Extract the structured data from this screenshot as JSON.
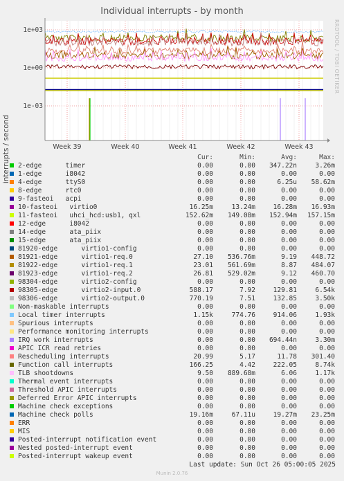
{
  "chart_data": {
    "type": "line",
    "title": "Individual interrupts - by month",
    "ylabel": "interrupts / second",
    "y_scale": "log",
    "y_ticks": [
      "1e+03",
      "1e+00",
      "1e-03"
    ],
    "x_ticks": [
      "Week 39",
      "Week 40",
      "Week 41",
      "Week 42",
      "Week 43"
    ],
    "grid": true,
    "legend_placement": "bottom",
    "series_levels": [
      {
        "name": "Local timer interrupts",
        "color": "#80c0ff",
        "level": 700,
        "style": "dense-dotted"
      },
      {
        "name": "Rescheduling interrupts",
        "color": "#e08070",
        "level": 20,
        "style": "spiky"
      },
      {
        "name": "Function call interrupts",
        "color": "#808000",
        "level": 200,
        "style": "spiky"
      },
      {
        "name": "98305-edge virtio2-input.0",
        "color": "#cc0000",
        "level": 120,
        "style": "spiky"
      },
      {
        "name": "98306-edge virtio2-output.0",
        "color": "#c08080",
        "level": 100,
        "style": "spiky"
      },
      {
        "name": "81921-edge virtio1-req.0",
        "color": "#a06000",
        "level": 9,
        "style": "spiky"
      },
      {
        "name": "TLB shootdowns",
        "color": "#ff99ff",
        "level": 6,
        "style": "spiky"
      },
      {
        "name": "12-edge i8042",
        "color": "#7f0000",
        "level": 1.2,
        "style": "noisy"
      },
      {
        "name": "10-fasteoi virtio0",
        "color": "#c0c000",
        "level": 0.0162,
        "style": "flat"
      },
      {
        "name": "11-fasteoi uhci_hcd:usb1, qxl",
        "color": "#cccc00",
        "level": 0.1529,
        "style": "flat"
      },
      {
        "name": "Machine check polls",
        "color": "#00007f",
        "level": 0.0193,
        "style": "flat"
      }
    ]
  },
  "credit": "RRDTOOL / TOBI OETIKER",
  "legend": {
    "headers": {
      "cur": "Cur:",
      "min": "Min:",
      "avg": "Avg:",
      "max": "Max:"
    },
    "rows": [
      {
        "color": "#00cc00",
        "name": "2-edge      timer",
        "cur": "0.00",
        "min": "0.00",
        "avg": "347.22n",
        "max": "3.26m"
      },
      {
        "color": "#0066b3",
        "name": "1-edge      i8042",
        "cur": "0.00",
        "min": "0.00",
        "avg": "0.00",
        "max": "0.00"
      },
      {
        "color": "#ff8000",
        "name": "4-edge      ttyS0",
        "cur": "0.00",
        "min": "0.00",
        "avg": "6.25u",
        "max": "58.62m"
      },
      {
        "color": "#ffcc00",
        "name": "8-edge      rtc0",
        "cur": "0.00",
        "min": "0.00",
        "avg": "0.00",
        "max": "0.00"
      },
      {
        "color": "#330099",
        "name": "9-fasteoi   acpi",
        "cur": "0.00",
        "min": "0.00",
        "avg": "0.00",
        "max": "0.00"
      },
      {
        "color": "#990099",
        "name": "10-fasteoi   virtio0",
        "cur": "16.25m",
        "min": "13.24m",
        "avg": "16.28m",
        "max": "16.93m"
      },
      {
        "color": "#ccff00",
        "name": "11-fasteoi   uhci_hcd:usb1, qxl",
        "cur": "152.62m",
        "min": "149.08m",
        "avg": "152.94m",
        "max": "157.15m"
      },
      {
        "color": "#ff0000",
        "name": "12-edge      i8042",
        "cur": "0.00",
        "min": "0.00",
        "avg": "0.00",
        "max": "0.00"
      },
      {
        "color": "#808080",
        "name": "14-edge      ata_piix",
        "cur": "0.00",
        "min": "0.00",
        "avg": "0.00",
        "max": "0.00"
      },
      {
        "color": "#008f00",
        "name": "15-edge      ata_piix",
        "cur": "0.00",
        "min": "0.00",
        "avg": "0.00",
        "max": "0.00"
      },
      {
        "color": "#00487d",
        "name": "81920-edge      virtio1-config",
        "cur": "0.00",
        "min": "0.00",
        "avg": "0.00",
        "max": "0.00"
      },
      {
        "color": "#b35a00",
        "name": "81921-edge      virtio1-req.0",
        "cur": "27.10",
        "min": "536.76m",
        "avg": "9.19",
        "max": "448.72"
      },
      {
        "color": "#b38f00",
        "name": "81922-edge      virtio1-req.1",
        "cur": "23.01",
        "min": "561.69m",
        "avg": "8.87",
        "max": "484.07"
      },
      {
        "color": "#6b006b",
        "name": "81923-edge      virtio1-req.2",
        "cur": "26.81",
        "min": "529.02m",
        "avg": "9.12",
        "max": "460.70"
      },
      {
        "color": "#8fb300",
        "name": "98304-edge      virtio2-config",
        "cur": "0.00",
        "min": "0.00",
        "avg": "0.00",
        "max": "0.00"
      },
      {
        "color": "#b30000",
        "name": "98305-edge      virtio2-input.0",
        "cur": "588.17",
        "min": "7.92",
        "avg": "129.81",
        "max": "6.54k"
      },
      {
        "color": "#bebebe",
        "name": "98306-edge      virtio2-output.0",
        "cur": "770.19",
        "min": "7.51",
        "avg": "132.85",
        "max": "3.50k"
      },
      {
        "color": "#80ff80",
        "name": "Non-maskable interrupts",
        "cur": "0.00",
        "min": "0.00",
        "avg": "0.00",
        "max": "0.00"
      },
      {
        "color": "#80c9ff",
        "name": "Local timer interrupts",
        "cur": "1.15k",
        "min": "774.76",
        "avg": "914.06",
        "max": "1.93k"
      },
      {
        "color": "#ffc080",
        "name": "Spurious interrupts",
        "cur": "0.00",
        "min": "0.00",
        "avg": "0.00",
        "max": "0.00"
      },
      {
        "color": "#ffe680",
        "name": "Performance monitoring interrupts",
        "cur": "0.00",
        "min": "0.00",
        "avg": "0.00",
        "max": "0.00"
      },
      {
        "color": "#aa80ff",
        "name": "IRQ work interrupts",
        "cur": "0.00",
        "min": "0.00",
        "avg": "694.44n",
        "max": "3.30m"
      },
      {
        "color": "#ee00cc",
        "name": "APIC ICR read retries",
        "cur": "0.00",
        "min": "0.00",
        "avg": "0.00",
        "max": "0.00"
      },
      {
        "color": "#ff8080",
        "name": "Rescheduling interrupts",
        "cur": "20.99",
        "min": "5.17",
        "avg": "11.78",
        "max": "301.40"
      },
      {
        "color": "#666600",
        "name": "Function call interrupts",
        "cur": "166.25",
        "min": "4.42",
        "avg": "222.05",
        "max": "8.74k"
      },
      {
        "color": "#ffbfff",
        "name": "TLB shootdowns",
        "cur": "9.50",
        "min": "889.68m",
        "avg": "6.06",
        "max": "1.17k"
      },
      {
        "color": "#00ffcc",
        "name": "Thermal event interrupts",
        "cur": "0.00",
        "min": "0.00",
        "avg": "0.00",
        "max": "0.00"
      },
      {
        "color": "#cc6699",
        "name": "Threshold APIC interrupts",
        "cur": "0.00",
        "min": "0.00",
        "avg": "0.00",
        "max": "0.00"
      },
      {
        "color": "#999900",
        "name": "Deferred Error APIC interrupts",
        "cur": "0.00",
        "min": "0.00",
        "avg": "0.00",
        "max": "0.00"
      },
      {
        "color": "#00cc00",
        "name": "Machine check exceptions",
        "cur": "0.00",
        "min": "0.00",
        "avg": "0.00",
        "max": "0.00"
      },
      {
        "color": "#0066b3",
        "name": "Machine check polls",
        "cur": "19.16m",
        "min": "67.11u",
        "avg": "19.27m",
        "max": "23.25m"
      },
      {
        "color": "#ff8000",
        "name": "ERR",
        "cur": "0.00",
        "min": "0.00",
        "avg": "0.00",
        "max": "0.00"
      },
      {
        "color": "#ffcc00",
        "name": "MIS",
        "cur": "0.00",
        "min": "0.00",
        "avg": "0.00",
        "max": "0.00"
      },
      {
        "color": "#330099",
        "name": "Posted-interrupt notification event",
        "cur": "0.00",
        "min": "0.00",
        "avg": "0.00",
        "max": "0.00"
      },
      {
        "color": "#990099",
        "name": "Nested posted-interrupt event",
        "cur": "0.00",
        "min": "0.00",
        "avg": "0.00",
        "max": "0.00"
      },
      {
        "color": "#ccff00",
        "name": "Posted-interrupt wakeup event",
        "cur": "0.00",
        "min": "0.00",
        "avg": "0.00",
        "max": "0.00"
      }
    ]
  },
  "last_update": "Last update: Sun Oct 26 05:00:05 2025",
  "munin_version": "Munin 2.0.76"
}
